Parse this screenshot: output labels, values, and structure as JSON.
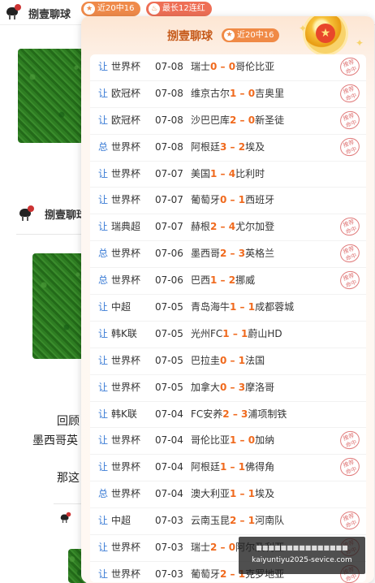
{
  "header": {
    "brand": "捌壹聊球",
    "badge_recent": "近20中16",
    "badge_streak": "最长12连红"
  },
  "background": {
    "post2_brand": "捌壹聊球",
    "snippet1": "回顾",
    "snippet2": "墨西哥英",
    "snippet3": "那这"
  },
  "popup": {
    "title": "捌壹聊球",
    "badge": "近20中16",
    "stamp_text": "推荐\n命中",
    "rows": [
      {
        "type": "让",
        "league": "世界杯",
        "date": "07-08",
        "home": "瑞士",
        "hs": "0",
        "as": "0",
        "away": "哥伦比亚"
      },
      {
        "type": "让",
        "league": "欧冠杯",
        "date": "07-08",
        "home": "维京古尔",
        "hs": "1",
        "as": "0",
        "away": "吉奥里"
      },
      {
        "type": "让",
        "league": "欧冠杯",
        "date": "07-08",
        "home": "沙巴巴库",
        "hs": "2",
        "as": "0",
        "away": "新圣徒"
      },
      {
        "type": "总",
        "league": "世界杯",
        "date": "07-08",
        "home": "阿根廷",
        "hs": "3",
        "as": "2",
        "away": "埃及"
      },
      {
        "type": "让",
        "league": "世界杯",
        "date": "07-07",
        "home": "美国",
        "hs": "1",
        "as": "4",
        "away": "比利时"
      },
      {
        "type": "让",
        "league": "世界杯",
        "date": "07-07",
        "home": "葡萄牙",
        "hs": "0",
        "as": "1",
        "away": "西班牙"
      },
      {
        "type": "让",
        "league": "瑞典超",
        "date": "07-07",
        "home": "赫根",
        "hs": "2",
        "as": "4",
        "away": "尤尔加登"
      },
      {
        "type": "总",
        "league": "世界杯",
        "date": "07-06",
        "home": "墨西哥",
        "hs": "2",
        "as": "3",
        "away": "英格兰"
      },
      {
        "type": "总",
        "league": "世界杯",
        "date": "07-06",
        "home": "巴西",
        "hs": "1",
        "as": "2",
        "away": "挪威"
      },
      {
        "type": "让",
        "league": "中超",
        "date": "07-05",
        "home": "青岛海牛",
        "hs": "1",
        "as": "1",
        "away": "成都蓉城"
      },
      {
        "type": "让",
        "league": "韩K联",
        "date": "07-05",
        "home": "光州FC",
        "hs": "1",
        "as": "1",
        "away": "蔚山HD"
      },
      {
        "type": "让",
        "league": "世界杯",
        "date": "07-05",
        "home": "巴拉圭",
        "hs": "0",
        "as": "1",
        "away": "法国"
      },
      {
        "type": "让",
        "league": "世界杯",
        "date": "07-05",
        "home": "加拿大",
        "hs": "0",
        "as": "3",
        "away": "摩洛哥"
      },
      {
        "type": "让",
        "league": "韩K联",
        "date": "07-04",
        "home": "FC安养",
        "hs": "2",
        "as": "3",
        "away": "浦项制铁"
      },
      {
        "type": "让",
        "league": "世界杯",
        "date": "07-04",
        "home": "哥伦比亚",
        "hs": "1",
        "as": "0",
        "away": "加纳"
      },
      {
        "type": "让",
        "league": "世界杯",
        "date": "07-04",
        "home": "阿根廷",
        "hs": "1",
        "as": "1",
        "away": "佛得角"
      },
      {
        "type": "总",
        "league": "世界杯",
        "date": "07-04",
        "home": "澳大利亚",
        "hs": "1",
        "as": "1",
        "away": "埃及"
      },
      {
        "type": "让",
        "league": "中超",
        "date": "07-03",
        "home": "云南玉昆",
        "hs": "2",
        "as": "1",
        "away": "河南队"
      },
      {
        "type": "让",
        "league": "世界杯",
        "date": "07-03",
        "home": "瑞士",
        "hs": "2",
        "as": "0",
        "away": "阿尔及利亚"
      },
      {
        "type": "让",
        "league": "世界杯",
        "date": "07-03",
        "home": "葡萄牙",
        "hs": "2",
        "as": "1",
        "away": "克罗地亚"
      }
    ],
    "stamped": [
      true,
      true,
      true,
      true,
      false,
      false,
      true,
      true,
      true,
      false,
      false,
      false,
      false,
      false,
      true,
      true,
      false,
      true,
      true,
      true
    ]
  },
  "watermark": {
    "line1": "■■■■■■■■■■■■■■■",
    "line2": "kaiyuntiyu2025-sevice.com"
  },
  "colors": {
    "accent": "#f06a1e",
    "type_blue": "#3a7bd5",
    "stamp_red": "#e07a7a"
  }
}
